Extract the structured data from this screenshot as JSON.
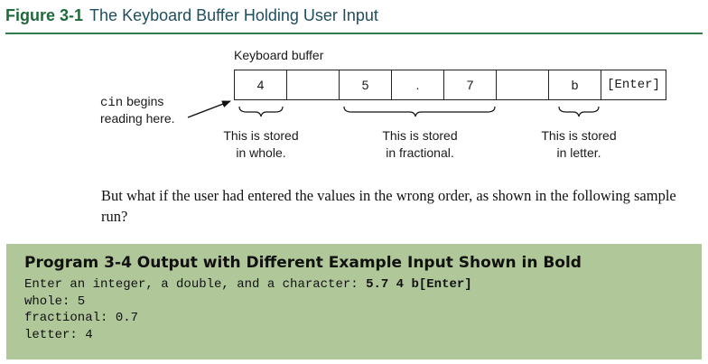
{
  "figure": {
    "number": "Figure 3-1",
    "title": "The Keyboard Buffer Holding User Input"
  },
  "diagram": {
    "buffer_label": "Keyboard buffer",
    "cells": [
      "4",
      "",
      "5",
      ".",
      "7",
      "",
      "b",
      "[Enter]"
    ],
    "cin_note": {
      "code": "cin",
      "line1_rest": " begins",
      "line2": "reading here."
    },
    "stored_notes": [
      {
        "line1": "This is stored",
        "line2": "in whole."
      },
      {
        "line1": "This is stored",
        "line2": "in fractional."
      },
      {
        "line1": "This is stored",
        "line2": "in letter."
      }
    ]
  },
  "paragraph": "But what if the user had entered the values in the wrong order, as shown in the following sample run?",
  "program": {
    "title": "Program 3-4 Output with Different Example Input Shown in Bold",
    "prompt": "Enter an integer, a double, and a character: ",
    "input": "5.7 4 b[Enter]",
    "lines": [
      "whole: 5",
      "fractional: 0.7",
      "letter: 4"
    ]
  },
  "colors": {
    "figure_number": "#1d6a3a",
    "figure_title": "#1f4e5f",
    "rule": "#2f7d4a",
    "program_background": "#b0c79a"
  }
}
